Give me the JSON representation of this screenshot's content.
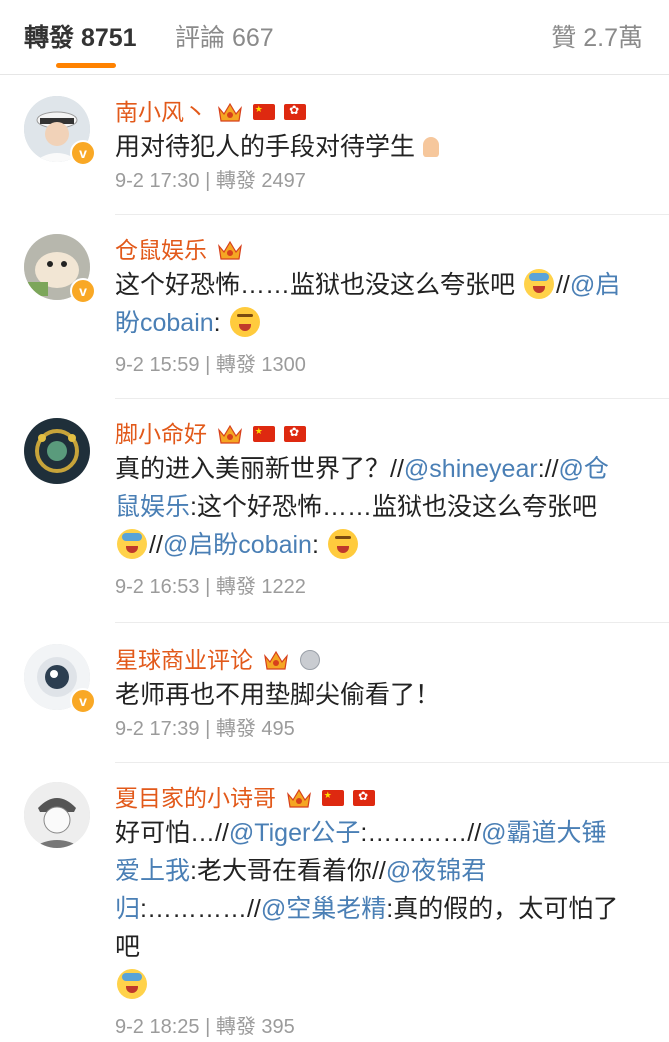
{
  "tabs": {
    "repost": "轉發 8751",
    "comment": "評論 667",
    "like": "贊 2.7萬"
  },
  "comments": [
    {
      "username": "南小风丶",
      "text": [
        "用对待犯人的手段对待学生"
      ],
      "date": "9-2 17:30",
      "repost": "轉發 2497"
    },
    {
      "username": "仓鼠娱乐",
      "text": [
        "这个好恐怖……监狱也没这么夸张吧",
        "//",
        "@启盼cobain",
        ":"
      ],
      "date": "9-2 15:59",
      "repost": "轉發 1300"
    },
    {
      "username": "脚小命好",
      "text": [
        "真的进入美丽新世界了？//",
        "@shineyear",
        "://",
        "@仓鼠娱乐",
        ":这个好恐怖……监狱也没这么夸张吧",
        "//",
        "@启盼cobain",
        ":"
      ],
      "date": "9-2 16:53",
      "repost": "轉發 1222"
    },
    {
      "username": "星球商业评论",
      "text": [
        "老师再也不用垫脚尖偷看了！"
      ],
      "date": "9-2 17:39",
      "repost": "轉發 495"
    },
    {
      "username": "夏目家的小诗哥",
      "text": [
        "好可怕…//",
        "@Tiger公子",
        ":…………//",
        "@霸道大锤爱上我",
        ":老大哥在看着你//",
        "@夜锦君归",
        ":…………//",
        "@空巢老精",
        ":真的假的，太可怕了吧"
      ],
      "date": "9-2 18:25",
      "repost": "轉發 395"
    }
  ],
  "separator": "|",
  "colors": {
    "accent": "#ff8200",
    "username": "#e2591a",
    "mention": "#4a7fb5",
    "meta": "#9b9b9b"
  }
}
